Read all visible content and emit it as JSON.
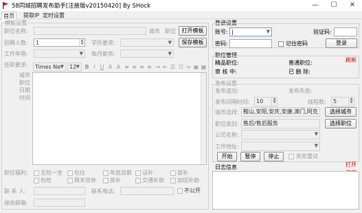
{
  "window": {
    "title": "58同城招聘发布助手[注册版v20150420]  By SHock",
    "minimize": "—",
    "maximize": "☐",
    "close": "✕"
  },
  "tabs": [
    "首页",
    "提取IP",
    "定时设置"
  ],
  "template": {
    "group_label": "模板设置",
    "job_name_label": "职位名称:",
    "city_label": "城市",
    "job_label": "职位",
    "open_template": "打开模板",
    "save_template": "保存模板",
    "hire_count_label": "招聘人数:",
    "hire_count_value": "1",
    "education_label": "学历要求:",
    "experience_label": "工作年限:",
    "salary_label": "每月薪资:",
    "requirements_label": "任职要求:",
    "font_name": "Times Ne",
    "font_size": "12",
    "placeholders": [
      "城市",
      "职位",
      "日期",
      "时间"
    ],
    "benefits_label": "职位福利:",
    "benefits": [
      "五险一金",
      "包住",
      "年底双薪",
      "话补",
      "饭补",
      "包吃",
      "周末双休",
      "房补",
      "交通补助",
      "加班补助"
    ],
    "contact_label": "联 系 人:",
    "phone_label": "联系电话:",
    "private_label": "不公开",
    "email_label": "接收邮箱:"
  },
  "login": {
    "group_label": "登录设置",
    "account_label": "账号:",
    "account_value": "|",
    "captcha_label": "验证码:",
    "password_label": "密码:",
    "remember_label": "记住密码",
    "login_button": "登录"
  },
  "manage": {
    "group_label": "职位管理",
    "fine_label": "精品职位:",
    "normal_label": "普通职位:",
    "refresh": "刷新",
    "reviewing_label": "审 核 中:",
    "deleted_label": "已 删 除:"
  },
  "publish": {
    "group_label": "发布设置",
    "success_label": "发布成功:",
    "fail_label": "发布失败:",
    "interval_label": "发布间隔时间:",
    "interval_value": "10",
    "thread_label": "线程数:",
    "thread_value": "5",
    "city_label": "城市选择:",
    "city_value": "鞍山,安阳,安庆,安康,澳门,阿克",
    "select_city": "选择城市",
    "category_label": "职位类别:",
    "category_value": "售后/售后服务",
    "select_job": "选择职位",
    "company_label": "公司名称:",
    "address_label": "工作地址:",
    "start": "开始",
    "pause": "暂停",
    "stop": "停止",
    "retry_label": "失败重试"
  },
  "log": {
    "label": "日志信息",
    "open": "打开",
    "clear": "清空"
  }
}
